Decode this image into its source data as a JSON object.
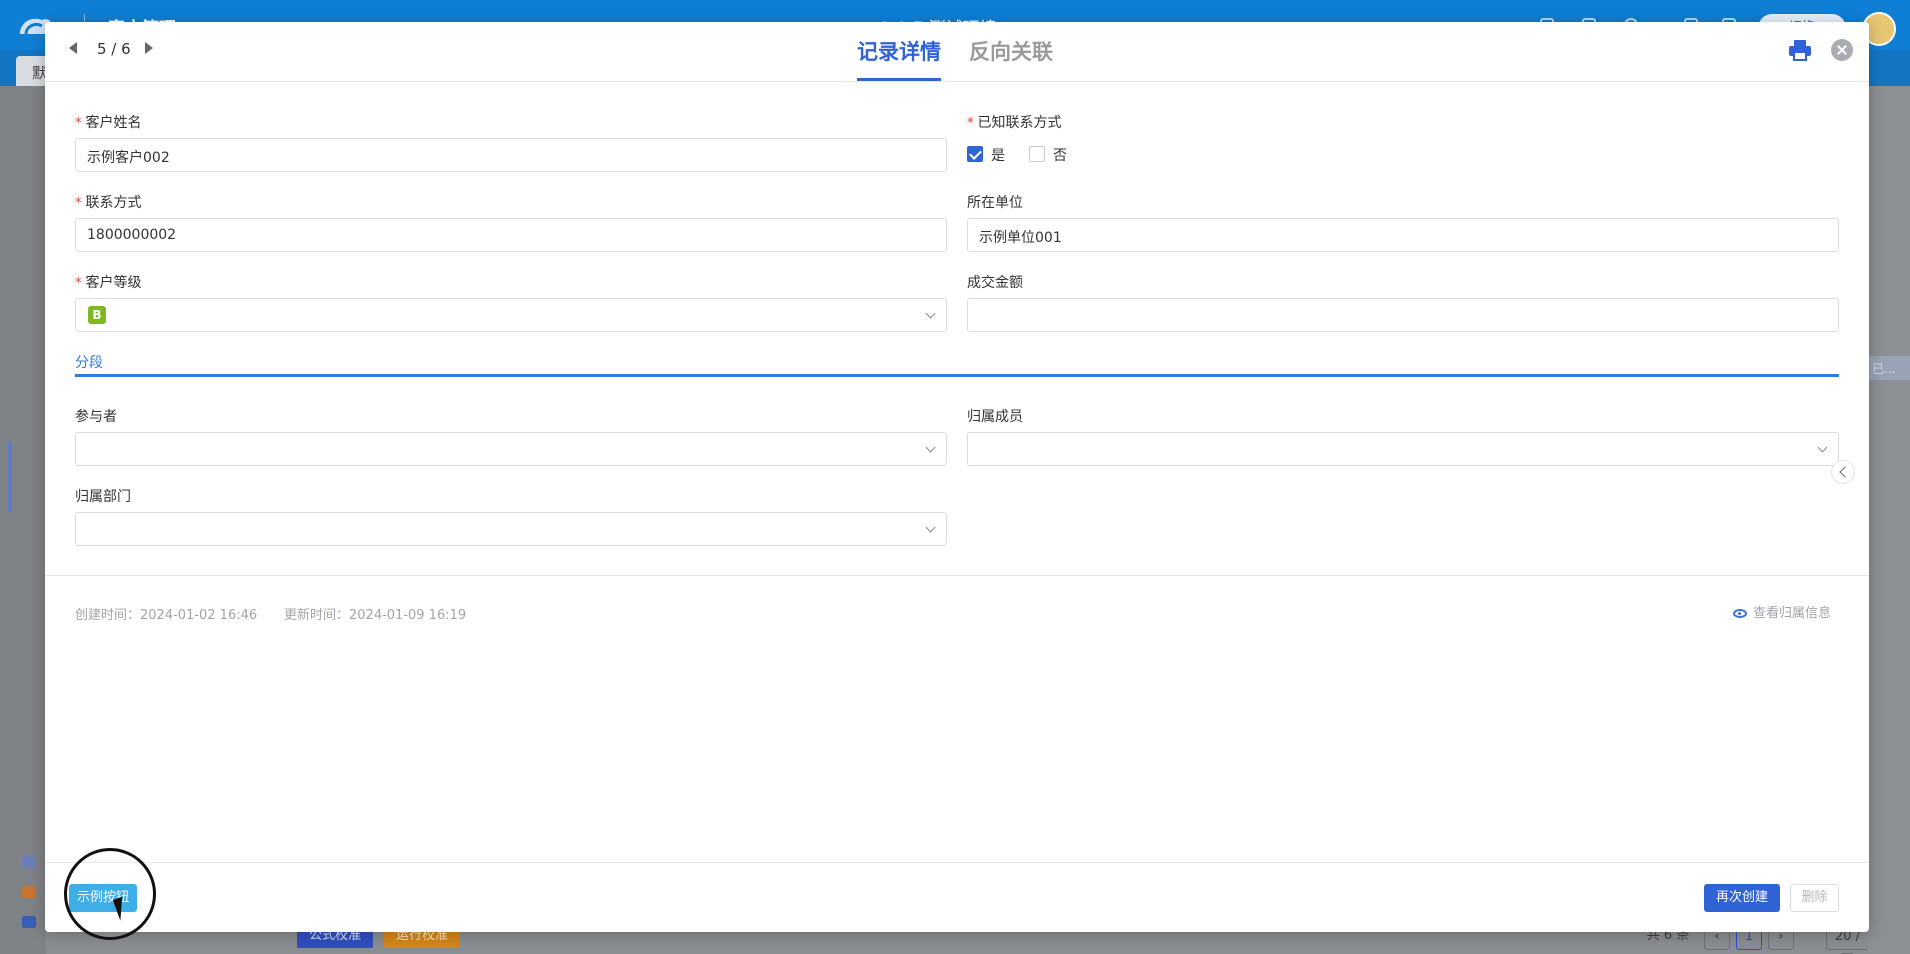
{
  "background": {
    "app_title": "客户管理",
    "center_title": "2.0.7 测试环境",
    "user_pill": "切换",
    "tab_label": "默",
    "right_cell": "已...",
    "bottom": {
      "tag1": "公式校准",
      "tag2": "运行校准",
      "total": "共 6 条",
      "page": "1",
      "page_size": "20 / 页"
    }
  },
  "modal": {
    "pager": "5 / 6",
    "tabs": {
      "detail": "记录详情",
      "reverse": "反向关联"
    },
    "fields": {
      "customer_name": {
        "label": "客户姓名",
        "required": "*",
        "value": "示例客户002"
      },
      "known_contact": {
        "label": "已知联系方式",
        "required": "*",
        "options": [
          {
            "label": "是",
            "checked": true
          },
          {
            "label": "否",
            "checked": false
          }
        ]
      },
      "contact": {
        "label": "联系方式",
        "required": "*",
        "value": "1800000002"
      },
      "company": {
        "label": "所在单位",
        "value": "示例单位001"
      },
      "level": {
        "label": "客户等级",
        "required": "*",
        "value": "B",
        "badge_color": "#82b81f"
      },
      "deal_amount": {
        "label": "成交金额",
        "value": ""
      },
      "participants": {
        "label": "参与者",
        "value": ""
      },
      "owner_member": {
        "label": "归属成员",
        "value": ""
      },
      "owner_department": {
        "label": "归属部门",
        "value": ""
      }
    },
    "section": {
      "title": "分段"
    },
    "meta": {
      "created": "创建时间：2024-01-02 16:46",
      "updated": "更新时间：2024-01-09 16:19",
      "view_owner": "查看归属信息"
    },
    "footer": {
      "sample_button": "示例按钮",
      "recreate_button": "再次创建",
      "delete_button": "删除"
    }
  },
  "colors": {
    "accent": "#2f63d6",
    "section": "#2f7cdc",
    "topbar": "#0f7fd6",
    "required": "#e53935"
  }
}
